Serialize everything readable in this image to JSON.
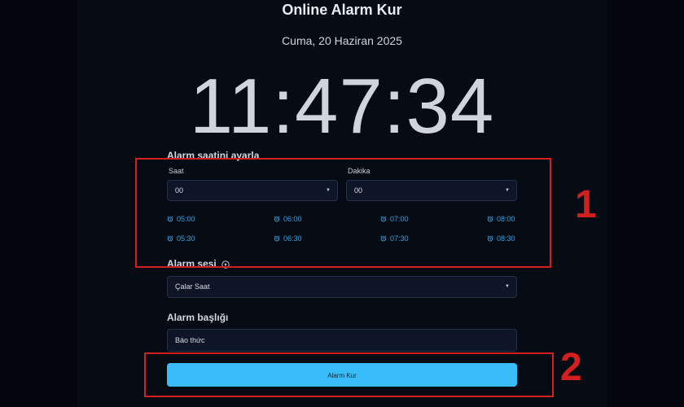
{
  "header": {
    "title": "Online Alarm Kur",
    "date": "Cuma, 20 Haziran 2025",
    "clock": "11:47:34"
  },
  "alarm_time": {
    "section_label": "Alarm saatini ayarla",
    "hour_label": "Saat",
    "hour_value": "00",
    "minute_label": "Dakika",
    "minute_value": "00",
    "presets": [
      "05:00",
      "06:00",
      "07:00",
      "08:00",
      "05:30",
      "06:30",
      "07:30",
      "08:30"
    ]
  },
  "alarm_sound": {
    "section_label": "Alarm sesi",
    "value": "Çalar Saat"
  },
  "alarm_title": {
    "section_label": "Alarm başlığı",
    "value": "Báo thức"
  },
  "submit_label": "Alarm Kur",
  "annotations": [
    "1",
    "2"
  ],
  "colors": {
    "accent": "#38bdf8",
    "preset_link": "#3aa2e0",
    "annotation": "#d21f1f",
    "background": "#03060c"
  }
}
